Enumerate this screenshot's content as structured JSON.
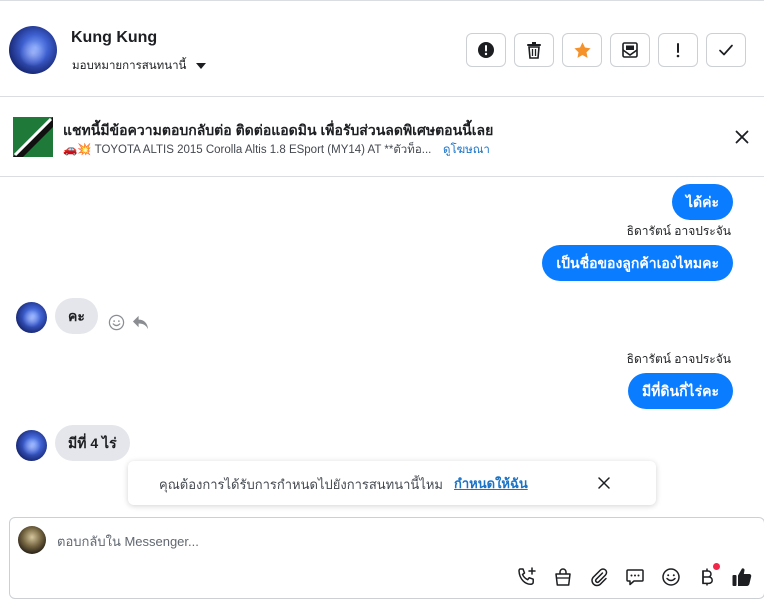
{
  "header": {
    "contact_name": "Kung Kung",
    "assign_label": "มอบหมายการสนทนานี้"
  },
  "toolbar": {
    "buttons": [
      {
        "name": "spam-button",
        "icon": "alert-circle-icon"
      },
      {
        "name": "delete-button",
        "icon": "trash-icon"
      },
      {
        "name": "star-button",
        "icon": "star-icon",
        "color": "#f5922a"
      },
      {
        "name": "mark-unread-button",
        "icon": "mail-icon"
      },
      {
        "name": "follow-up-button",
        "icon": "exclamation-icon"
      },
      {
        "name": "mark-done-button",
        "icon": "check-icon"
      }
    ]
  },
  "banner": {
    "title": "แชทนี้มีข้อความตอบกลับต่อ ติดต่อแอดมิน เพื่อรับส่วนลดพิเศษตอนนี้เลย",
    "subtitle": "🚗💥 TOYOTA ALTIS 2015 Corolla Altis 1.8 ESport (MY14) AT **ตัวท็อ...",
    "link": "ดูโฆษณา"
  },
  "messages": {
    "m1": "ได้ค่ะ",
    "sender1": "ธิดารัตน์ อาจประจัน",
    "m2": "เป็นชื่อของลูกค้าเองไหมคะ",
    "m3": "คะ",
    "sender2": "ธิดารัตน์ อาจประจัน",
    "m4": "มีที่ดินกี่ไร่คะ",
    "m5": "มีที่ 4 ไร่"
  },
  "toast": {
    "text": "คุณต้องการได้รับการกำหนดไปยังการสนทนานี้ไหม",
    "link": "กำหนดให้ฉัน"
  },
  "composer": {
    "placeholder": "ตอบกลับใน Messenger...",
    "icons": [
      "call-add-icon",
      "shopping-bag-icon",
      "attachment-icon",
      "saved-reply-icon",
      "emoji-icon",
      "baht-payment-icon",
      "thumbs-up-icon"
    ]
  },
  "colors": {
    "outgoing_bubble": "#0a7cff",
    "incoming_bubble": "#e4e6eb",
    "link": "#1a73c7",
    "star": "#f5922a",
    "notification_dot": "#f02849"
  }
}
